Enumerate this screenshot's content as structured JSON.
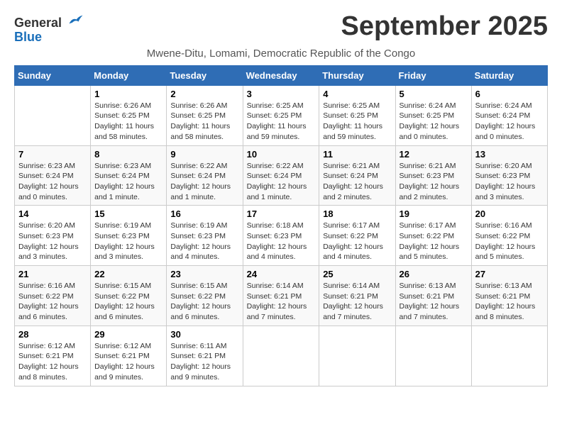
{
  "logo": {
    "general": "General",
    "blue": "Blue"
  },
  "title": "September 2025",
  "subtitle": "Mwene-Ditu, Lomami, Democratic Republic of the Congo",
  "days_of_week": [
    "Sunday",
    "Monday",
    "Tuesday",
    "Wednesday",
    "Thursday",
    "Friday",
    "Saturday"
  ],
  "weeks": [
    [
      {
        "day": "",
        "info": ""
      },
      {
        "day": "1",
        "info": "Sunrise: 6:26 AM\nSunset: 6:25 PM\nDaylight: 11 hours\nand 58 minutes."
      },
      {
        "day": "2",
        "info": "Sunrise: 6:26 AM\nSunset: 6:25 PM\nDaylight: 11 hours\nand 58 minutes."
      },
      {
        "day": "3",
        "info": "Sunrise: 6:25 AM\nSunset: 6:25 PM\nDaylight: 11 hours\nand 59 minutes."
      },
      {
        "day": "4",
        "info": "Sunrise: 6:25 AM\nSunset: 6:25 PM\nDaylight: 11 hours\nand 59 minutes."
      },
      {
        "day": "5",
        "info": "Sunrise: 6:24 AM\nSunset: 6:25 PM\nDaylight: 12 hours\nand 0 minutes."
      },
      {
        "day": "6",
        "info": "Sunrise: 6:24 AM\nSunset: 6:24 PM\nDaylight: 12 hours\nand 0 minutes."
      }
    ],
    [
      {
        "day": "7",
        "info": "Sunrise: 6:23 AM\nSunset: 6:24 PM\nDaylight: 12 hours\nand 0 minutes."
      },
      {
        "day": "8",
        "info": "Sunrise: 6:23 AM\nSunset: 6:24 PM\nDaylight: 12 hours\nand 1 minute."
      },
      {
        "day": "9",
        "info": "Sunrise: 6:22 AM\nSunset: 6:24 PM\nDaylight: 12 hours\nand 1 minute."
      },
      {
        "day": "10",
        "info": "Sunrise: 6:22 AM\nSunset: 6:24 PM\nDaylight: 12 hours\nand 1 minute."
      },
      {
        "day": "11",
        "info": "Sunrise: 6:21 AM\nSunset: 6:24 PM\nDaylight: 12 hours\nand 2 minutes."
      },
      {
        "day": "12",
        "info": "Sunrise: 6:21 AM\nSunset: 6:23 PM\nDaylight: 12 hours\nand 2 minutes."
      },
      {
        "day": "13",
        "info": "Sunrise: 6:20 AM\nSunset: 6:23 PM\nDaylight: 12 hours\nand 3 minutes."
      }
    ],
    [
      {
        "day": "14",
        "info": "Sunrise: 6:20 AM\nSunset: 6:23 PM\nDaylight: 12 hours\nand 3 minutes."
      },
      {
        "day": "15",
        "info": "Sunrise: 6:19 AM\nSunset: 6:23 PM\nDaylight: 12 hours\nand 3 minutes."
      },
      {
        "day": "16",
        "info": "Sunrise: 6:19 AM\nSunset: 6:23 PM\nDaylight: 12 hours\nand 4 minutes."
      },
      {
        "day": "17",
        "info": "Sunrise: 6:18 AM\nSunset: 6:23 PM\nDaylight: 12 hours\nand 4 minutes."
      },
      {
        "day": "18",
        "info": "Sunrise: 6:17 AM\nSunset: 6:22 PM\nDaylight: 12 hours\nand 4 minutes."
      },
      {
        "day": "19",
        "info": "Sunrise: 6:17 AM\nSunset: 6:22 PM\nDaylight: 12 hours\nand 5 minutes."
      },
      {
        "day": "20",
        "info": "Sunrise: 6:16 AM\nSunset: 6:22 PM\nDaylight: 12 hours\nand 5 minutes."
      }
    ],
    [
      {
        "day": "21",
        "info": "Sunrise: 6:16 AM\nSunset: 6:22 PM\nDaylight: 12 hours\nand 6 minutes."
      },
      {
        "day": "22",
        "info": "Sunrise: 6:15 AM\nSunset: 6:22 PM\nDaylight: 12 hours\nand 6 minutes."
      },
      {
        "day": "23",
        "info": "Sunrise: 6:15 AM\nSunset: 6:22 PM\nDaylight: 12 hours\nand 6 minutes."
      },
      {
        "day": "24",
        "info": "Sunrise: 6:14 AM\nSunset: 6:21 PM\nDaylight: 12 hours\nand 7 minutes."
      },
      {
        "day": "25",
        "info": "Sunrise: 6:14 AM\nSunset: 6:21 PM\nDaylight: 12 hours\nand 7 minutes."
      },
      {
        "day": "26",
        "info": "Sunrise: 6:13 AM\nSunset: 6:21 PM\nDaylight: 12 hours\nand 7 minutes."
      },
      {
        "day": "27",
        "info": "Sunrise: 6:13 AM\nSunset: 6:21 PM\nDaylight: 12 hours\nand 8 minutes."
      }
    ],
    [
      {
        "day": "28",
        "info": "Sunrise: 6:12 AM\nSunset: 6:21 PM\nDaylight: 12 hours\nand 8 minutes."
      },
      {
        "day": "29",
        "info": "Sunrise: 6:12 AM\nSunset: 6:21 PM\nDaylight: 12 hours\nand 9 minutes."
      },
      {
        "day": "30",
        "info": "Sunrise: 6:11 AM\nSunset: 6:21 PM\nDaylight: 12 hours\nand 9 minutes."
      },
      {
        "day": "",
        "info": ""
      },
      {
        "day": "",
        "info": ""
      },
      {
        "day": "",
        "info": ""
      },
      {
        "day": "",
        "info": ""
      }
    ]
  ]
}
